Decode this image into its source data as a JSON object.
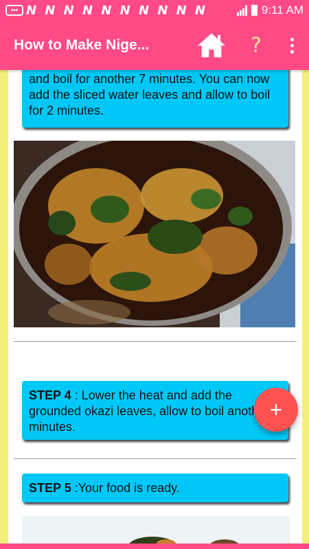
{
  "status_bar": {
    "notifications": "N N N N N N N N N N",
    "time": "9:11 AM"
  },
  "app_bar": {
    "title": "How to Make Nige...",
    "help_glyph": "?"
  },
  "step3_tail": {
    "text": "and boil for another 7 minutes. You can now add the sliced water leaves and allow to boil for 2 minutes."
  },
  "step4": {
    "label": "STEP 4",
    "text": " : Lower the heat and add the grounded okazi leaves, allow to boil another 2 minutes."
  },
  "step5": {
    "label": "STEP 5",
    "text": " :Your food is ready."
  },
  "fab": {
    "glyph": "+"
  },
  "colors": {
    "accent": "#ff4a86",
    "card": "#00c8f6",
    "fab": "#ff5252",
    "side_border": "#f3ef7a"
  },
  "icons": [
    "message-icon",
    "signal-icon",
    "battery-icon",
    "home-icon",
    "help-icon",
    "more-vert-icon",
    "add-icon"
  ]
}
